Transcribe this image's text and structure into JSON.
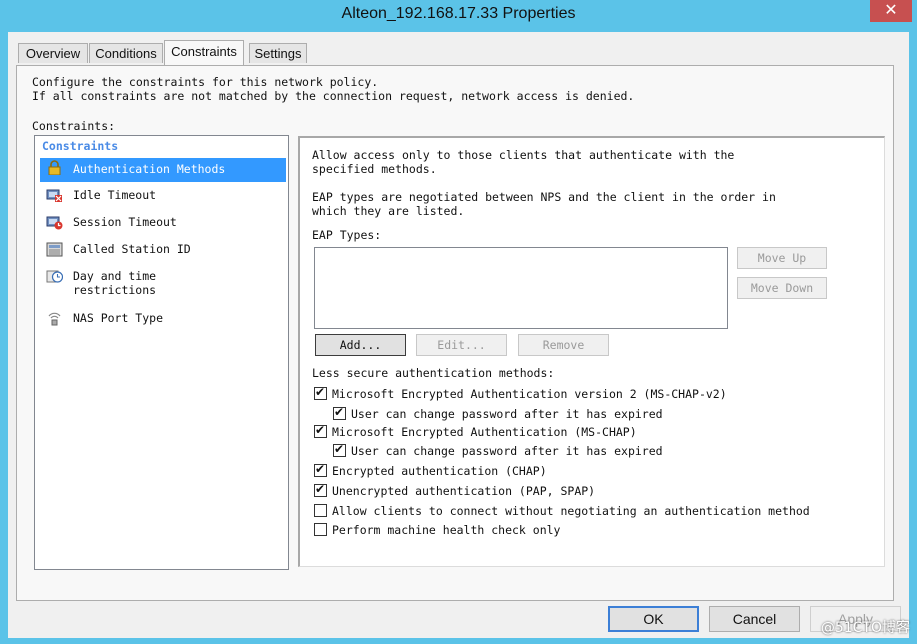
{
  "window": {
    "title": "Alteon_192.168.17.33 Properties",
    "close_glyph": "✕"
  },
  "tabs": [
    {
      "label": "Overview"
    },
    {
      "label": "Conditions"
    },
    {
      "label": "Constraints",
      "active": true
    },
    {
      "label": "Settings"
    }
  ],
  "intro": {
    "line1": "Configure the constraints for this network policy.",
    "line2": "If all constraints are not matched by the connection request, network access is denied."
  },
  "constraints_label": "Constraints:",
  "constraint_list": {
    "header": "Constraints",
    "items": [
      {
        "label": "Authentication Methods",
        "icon": "lock-icon",
        "selected": true
      },
      {
        "label": "Idle Timeout",
        "icon": "idle-timeout-icon"
      },
      {
        "label": "Session Timeout",
        "icon": "session-timeout-icon"
      },
      {
        "label": "Called Station ID",
        "icon": "called-station-icon"
      },
      {
        "label": "Day and time\nrestrictions",
        "icon": "clock-icon"
      },
      {
        "label": "NAS Port Type",
        "icon": "nas-port-icon"
      }
    ]
  },
  "auth": {
    "allow_text": "Allow access only to those clients that authenticate with the\nspecified methods.",
    "eap_text": "EAP types are negotiated between NPS and the client in the order in\nwhich they are listed.",
    "eap_label": "EAP Types:",
    "move_up": "Move Up",
    "move_down": "Move Down",
    "add": "Add...",
    "edit": "Edit...",
    "remove": "Remove",
    "less_secure_label": "Less secure authentication methods:",
    "options": [
      {
        "label": "Microsoft Encrypted Authentication version 2 (MS-CHAP-v2)",
        "checked": true
      },
      {
        "label": "User can change password after it has expired",
        "checked": true
      },
      {
        "label": "Microsoft Encrypted Authentication (MS-CHAP)",
        "checked": true
      },
      {
        "label": "User can change password after it has expired",
        "checked": true
      },
      {
        "label": "Encrypted authentication (CHAP)",
        "checked": true
      },
      {
        "label": "Unencrypted authentication (PAP, SPAP)",
        "checked": true
      },
      {
        "label": "Allow clients to connect without negotiating an authentication method",
        "checked": false
      },
      {
        "label": "Perform machine health check only",
        "checked": false
      }
    ]
  },
  "footer": {
    "ok": "OK",
    "cancel": "Cancel",
    "apply": "Apply"
  },
  "watermark": "@51CTO博客",
  "colors": {
    "titlebar": "#5bc3e8",
    "selection": "#3399ff",
    "close": "#c75050"
  }
}
